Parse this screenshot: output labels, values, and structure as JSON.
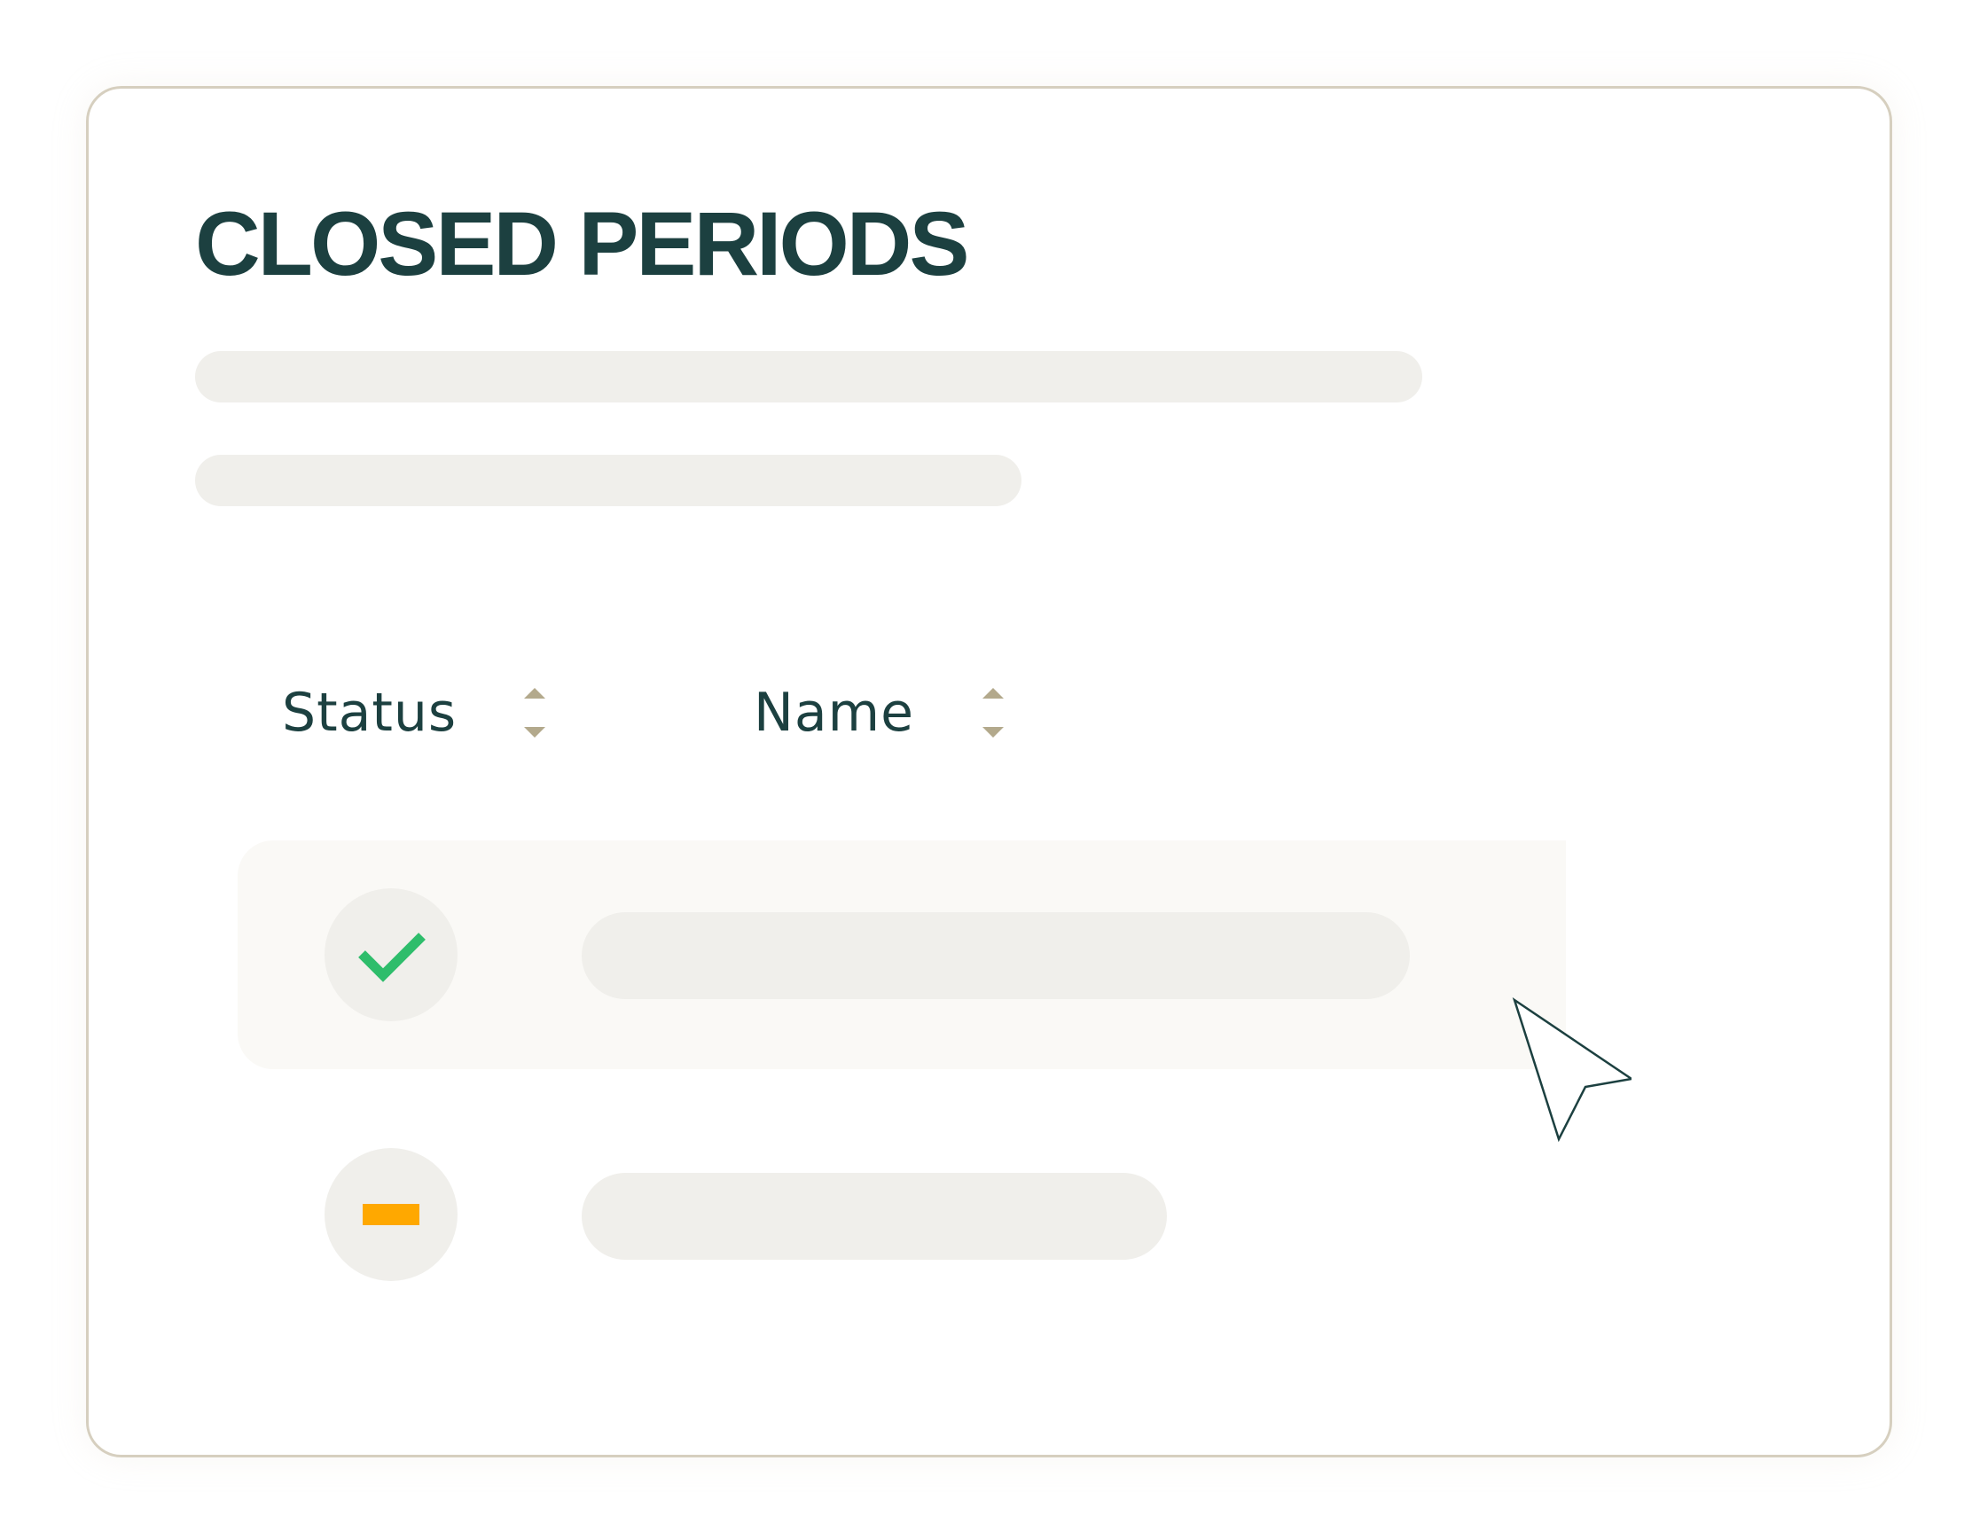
{
  "page": {
    "title": "CLOSED PERIODS"
  },
  "table": {
    "columns": [
      {
        "label": "Status",
        "sortable": true,
        "sort_icon": "sort-arrows-icon"
      },
      {
        "label": "Name",
        "sortable": true,
        "sort_icon": "sort-arrows-icon"
      }
    ],
    "rows": [
      {
        "status_icon": "check-icon",
        "status_color": "#2ebd6b",
        "hovered": true
      },
      {
        "status_icon": "minus-icon",
        "status_color": "#ffa800",
        "hovered": false
      }
    ]
  },
  "colors": {
    "title": "#1c4040",
    "card_border": "#d6cfbf",
    "skeleton": "#f0efeb",
    "row_highlight": "#faf9f6",
    "sort_arrow": "#b3a98c",
    "status_ok": "#2ebd6b",
    "status_pending": "#ffa800"
  },
  "pointer": {
    "icon": "cursor-arrow-icon"
  }
}
